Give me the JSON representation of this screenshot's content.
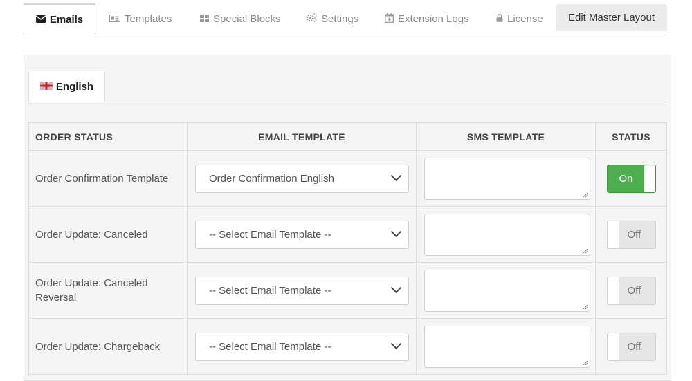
{
  "tabs": [
    {
      "label": "Emails",
      "icon": "envelope-icon",
      "active": true
    },
    {
      "label": "Templates",
      "icon": "template-icon"
    },
    {
      "label": "Special Blocks",
      "icon": "blocks-icon"
    },
    {
      "label": "Settings",
      "icon": "cogs-icon"
    },
    {
      "label": "Extension Logs",
      "icon": "calendar-icon"
    },
    {
      "label": "License",
      "icon": "lock-icon"
    },
    {
      "label": "Edit Master Layout"
    }
  ],
  "language_tab": {
    "label": "English",
    "icon": "uk-flag-icon"
  },
  "table": {
    "headers": {
      "order_status": "ORDER STATUS",
      "email_template": "EMAIL TEMPLATE",
      "sms_template": "SMS TEMPLATE",
      "status": "STATUS"
    },
    "rows": [
      {
        "order_status": "Order Confirmation Template",
        "email_template": "Order Confirmation English",
        "sms_template": "",
        "status": "On"
      },
      {
        "order_status": "Order Update: Canceled",
        "email_template": "-- Select Email Template --",
        "sms_template": "",
        "status": "Off"
      },
      {
        "order_status": "Order Update: Canceled Reversal",
        "email_template": "-- Select Email Template --",
        "sms_template": "",
        "status": "Off"
      },
      {
        "order_status": "Order Update: Chargeback",
        "email_template": "-- Select Email Template --",
        "sms_template": "",
        "status": "Off"
      }
    ]
  },
  "colors": {
    "toggle_on": "#4cae4c",
    "toggle_off": "#e6e6e6"
  }
}
